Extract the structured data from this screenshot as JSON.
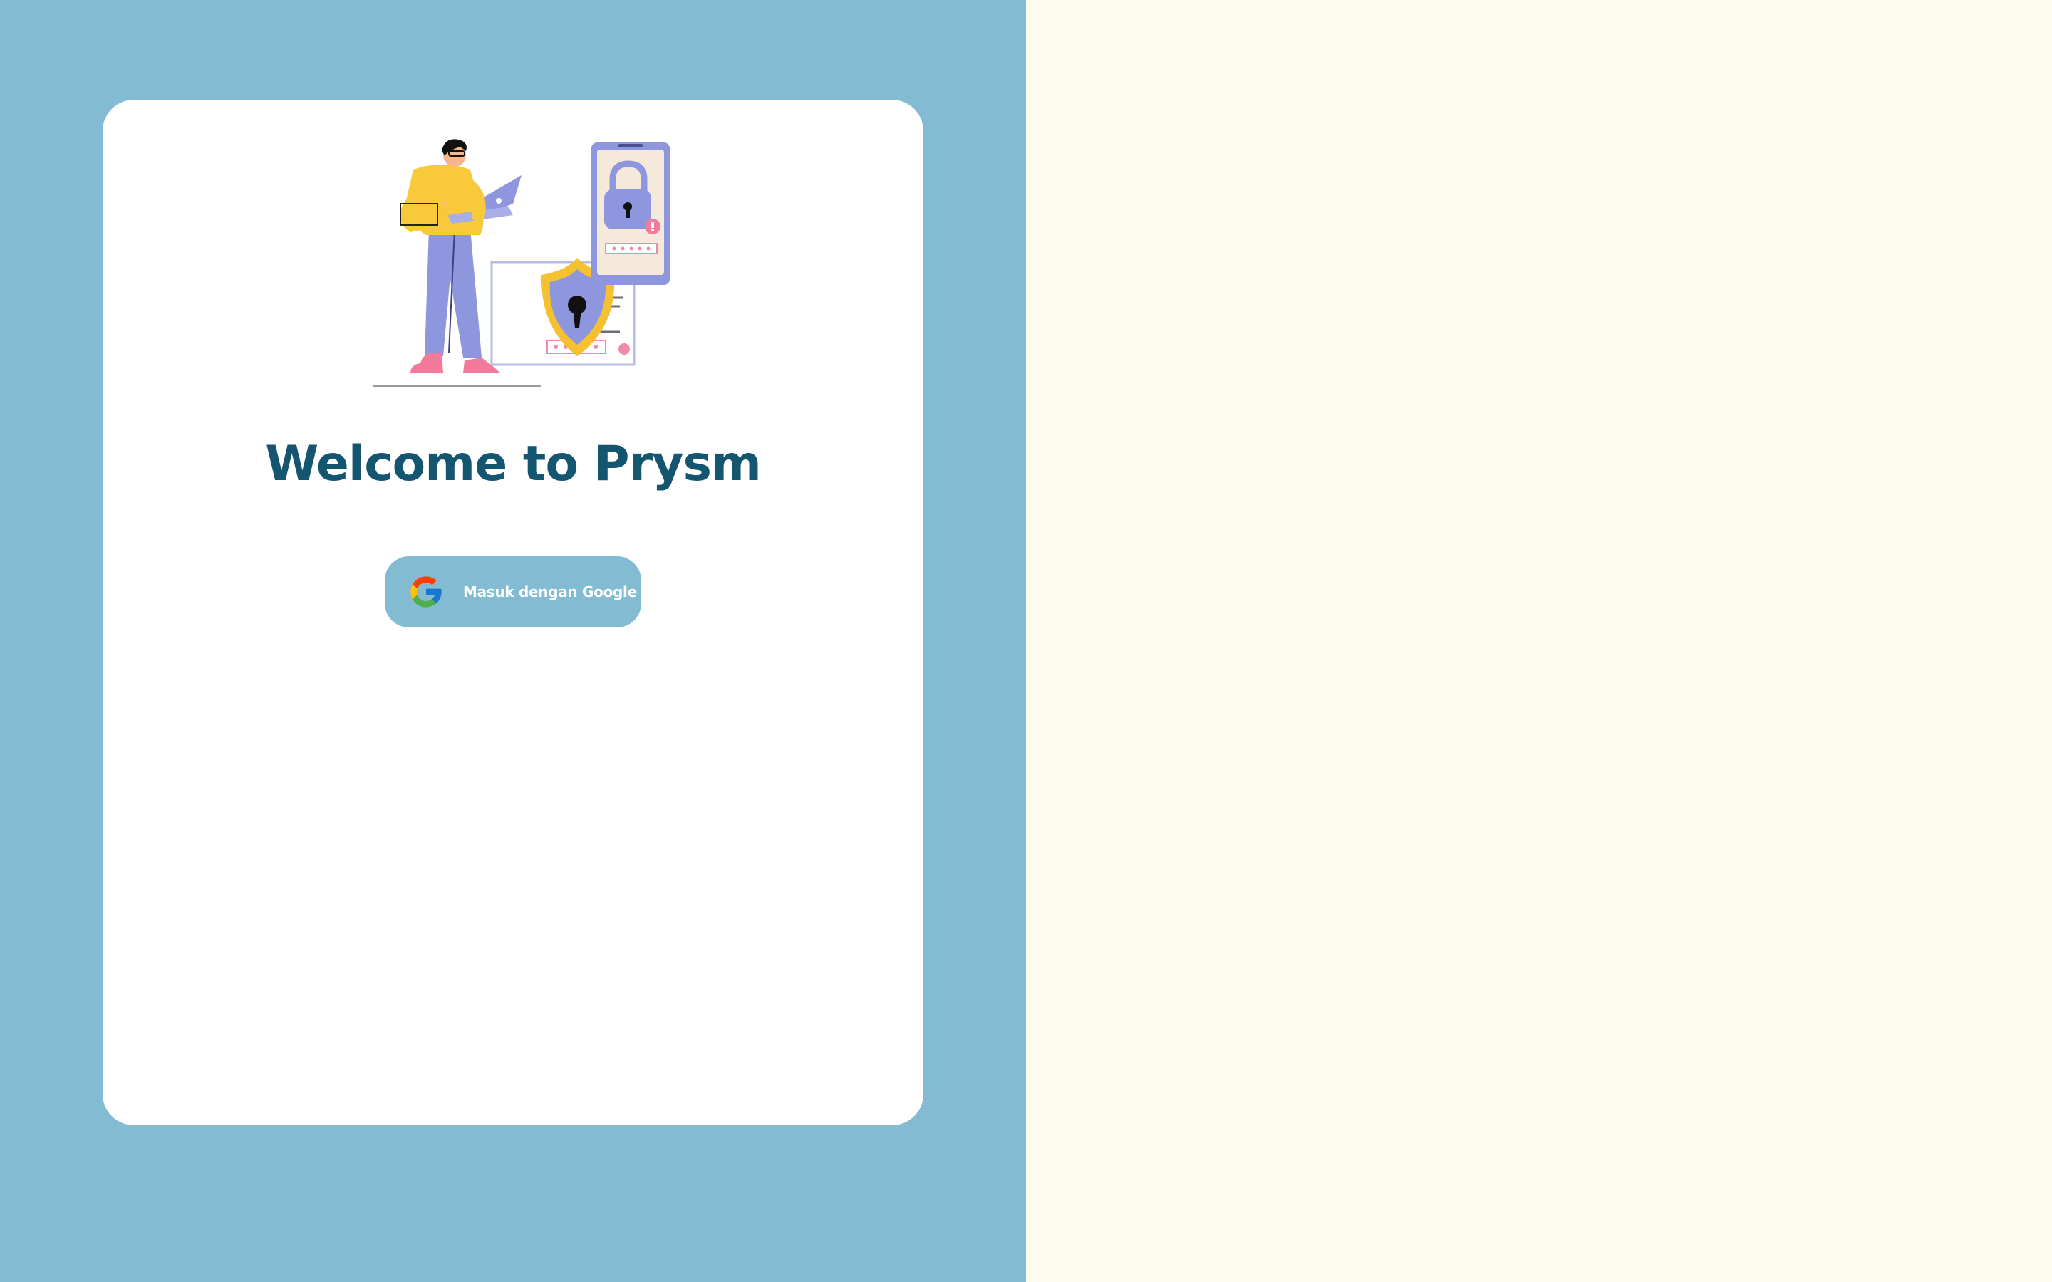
{
  "login": {
    "title": "Welcome to Prysm",
    "google_button_label": "Masuk dengan Google"
  },
  "icons": {
    "google": "google-g-icon",
    "illustration": "security-login-illustration"
  },
  "colors": {
    "left_background": "#82BBD2",
    "right_background": "#FDFAEE",
    "card_background": "#FFFFFF",
    "title_color": "#14566F",
    "button_background": "#82BBD2",
    "button_text": "#FFFFFF"
  }
}
